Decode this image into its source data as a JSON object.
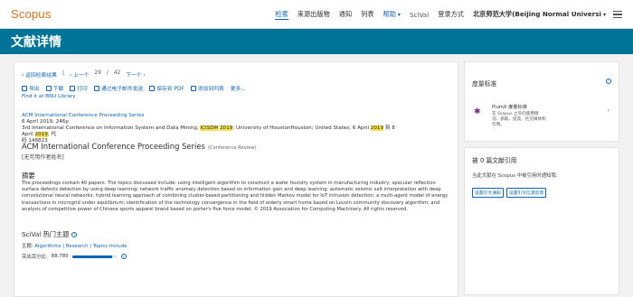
{
  "header": {
    "logo": "Scopus",
    "nav": [
      "检索",
      "来源出版物",
      "通知",
      "列表"
    ],
    "help": "帮助",
    "scival": "SciVal",
    "login_label": "登录方式",
    "institution": "北京师范大学(Beijing Normal Universi"
  },
  "title_band": "文献详情",
  "pager": {
    "back": "返回检索结果",
    "prev": "上一个",
    "current": "29",
    "sep": "/",
    "total": "42",
    "next": "下一个"
  },
  "tools": [
    "导出",
    "下载",
    "打印",
    "通过电子邮件发送",
    "保存到 PDF",
    "添加到列表",
    "更多..."
  ],
  "find_it": "Find it at BNU Library",
  "source": {
    "series": "ACM International Conference Proceeding Series",
    "date_pages": "6 April 2019, 246p",
    "conf_a": "3rd International Conference on Information System and Data Mining,",
    "conf_hl1": "ICISDM",
    "conf_hl2": "2019",
    "conf_b": "; University of HoustonHouston; United States; 6 April",
    "conf_hl3": "2019",
    "conf_c": "到 8 April",
    "conf_hl4": "2019",
    "conf_d": "; 代",
    "code": "码 148823"
  },
  "doc_title": "ACM International Conference Proceeding Series",
  "doc_type": "(Conference Review)",
  "no_title": "[无可用作者姓名]",
  "abstract": {
    "heading": "摘要",
    "text": "The proceedings contain 40 papers. The topics discussed include: using intelligent algorithm to construct a wafer foundry system in manufacturing industry; specular reflection surface defects detection by using deep learning; network traffic anomaly detection based on information gain and deep learning; automatic seismic salt interpretation with deep convolutional neural networks; hybrid learning approach of combining cluster-based partitioning and hidden Markov model for IoT intrusion detection; a multi-agent model of energy transactions in microgrid under equilibrium; identification of the technology convergence in the field of elderly smart home based on Louvin community discovery algorithm; and analysis of competitive power of Chinese sports apparel brand based on porter's five force model. © 2019 Association for Computing Machinery. All rights reserved."
  },
  "scival": {
    "heading": "SciVal 热门主题",
    "topic_label": "主题:",
    "topic_value": "Algorithms | Research | Topics Include",
    "percentile_label": "突出百分比:",
    "percentile_value": "88.780",
    "percentile_fraction": 0.8878
  },
  "metrics": {
    "heading": "度量标准",
    "plumx_title": "PlumX 度量标准",
    "plumx_desc": "在 Scopus 之外的使用情况、抓取、提及、社交媒体和引用。"
  },
  "cited": {
    "heading": "被 0 篇文献引用",
    "sub": "当此文献在 Scopus 中被引用时通知我:",
    "btn1": "设置引文通知",
    "btn2": "设置引文信源反馈"
  },
  "colors": {
    "brand": "#e9711c",
    "band": "#007398",
    "link": "#0b64b9",
    "highlight": "#f6e04a"
  }
}
